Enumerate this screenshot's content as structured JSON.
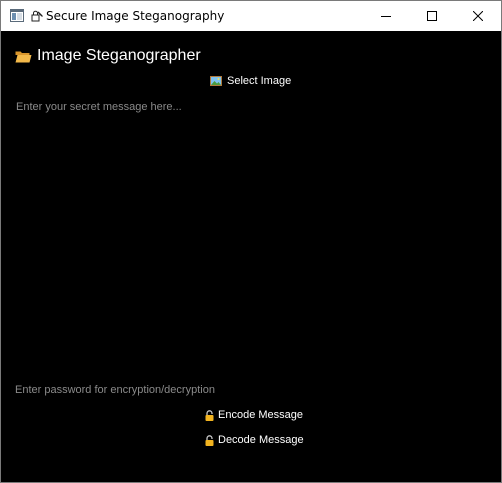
{
  "window": {
    "title": "Secure Image Steganography",
    "app_icon": "window-app-icon",
    "title_icon": "lock-with-pen-icon",
    "controls": {
      "minimize": "minimize-icon",
      "maximize": "maximize-icon",
      "close": "close-icon"
    }
  },
  "header": {
    "icon": "open-folder-icon",
    "title": "Image Steganographer"
  },
  "select_image": {
    "icon": "framed-picture-icon",
    "label": "Select Image"
  },
  "message": {
    "placeholder": "Enter your secret message here...",
    "value": ""
  },
  "password": {
    "placeholder": "Enter password for encryption/decryption",
    "value": ""
  },
  "actions": {
    "encode": {
      "icon": "lock-icon",
      "label": "Encode Message"
    },
    "decode": {
      "icon": "lock-icon",
      "label": "Decode Message"
    }
  },
  "colors": {
    "background": "#000000",
    "text": "#ffffff",
    "placeholder": "#8a8a8a",
    "titlebar": "#ffffff",
    "folder": "#f0b040",
    "lock": "#f2b420"
  }
}
